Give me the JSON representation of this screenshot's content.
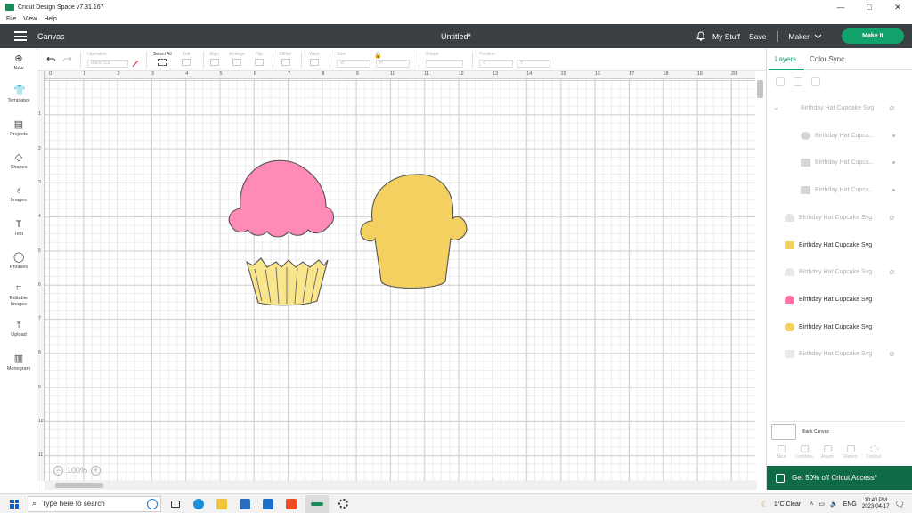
{
  "window": {
    "title": "Cricut Design Space  v7.31.167",
    "minimize": "—",
    "maximize": "□",
    "close": "✕"
  },
  "menu": [
    "File",
    "View",
    "Help"
  ],
  "header": {
    "canvas_label": "Canvas",
    "doc_title": "Untitled*",
    "my_stuff": "My Stuff",
    "save": "Save",
    "machine": "Maker",
    "make_it": "Make It"
  },
  "toolbar": {
    "operation": "Operation",
    "operation_value": "Basic Cut",
    "select_all": "Select All",
    "edit": "Edit",
    "align": "Align",
    "arrange": "Arrange",
    "flip": "Flip",
    "offset": "Offset",
    "warp": "Warp",
    "size": "Size",
    "rotate": "Rotate",
    "position": "Position",
    "w": "W",
    "h": "H",
    "x": "X",
    "y": "Y"
  },
  "leftnav": [
    {
      "label": "New",
      "icon": "plus-icon"
    },
    {
      "label": "Templates",
      "icon": "shirt-icon"
    },
    {
      "label": "Projects",
      "icon": "projects-icon"
    },
    {
      "label": "Shapes",
      "icon": "shapes-icon"
    },
    {
      "label": "Images",
      "icon": "bulb-icon"
    },
    {
      "label": "Text",
      "icon": "text-icon"
    },
    {
      "label": "Phrases",
      "icon": "chat-icon"
    },
    {
      "label": "Editable Images",
      "icon": "editable-icon"
    },
    {
      "label": "Upload",
      "icon": "upload-icon"
    },
    {
      "label": "Monogram",
      "icon": "monogram-icon"
    }
  ],
  "ruler": {
    "top": [
      "0",
      "1",
      "2",
      "3",
      "4",
      "5",
      "6",
      "7",
      "8",
      "9",
      "10",
      "11",
      "12",
      "13",
      "14",
      "15",
      "16",
      "17",
      "18",
      "19",
      "20"
    ],
    "left": [
      "1",
      "2",
      "3",
      "4",
      "5",
      "6",
      "7",
      "8",
      "9",
      "10",
      "11"
    ]
  },
  "zoom": {
    "minus": "−",
    "value": "100%",
    "plus": "+"
  },
  "panel": {
    "tab_layers": "Layers",
    "tab_color_sync": "Color Sync",
    "layers": [
      {
        "name": "Birthday Hat Cupcake Svg",
        "active": false,
        "kind": "group"
      },
      {
        "name": "Birthday Hat Cupca...",
        "active": false,
        "kind": "child"
      },
      {
        "name": "Birthday Hat Cupca...",
        "active": false,
        "kind": "child"
      },
      {
        "name": "Birthday Hat Cupca...",
        "active": false,
        "kind": "child"
      },
      {
        "name": "Birthday Hat Cupcake Svg",
        "active": false,
        "kind": "layer"
      },
      {
        "name": "Birthday Hat Cupcake Svg",
        "active": true,
        "kind": "layer"
      },
      {
        "name": "Birthday Hat Cupcake Svg",
        "active": false,
        "kind": "layer"
      },
      {
        "name": "Birthday Hat Cupcake Svg",
        "active": true,
        "kind": "layer"
      },
      {
        "name": "Birthday Hat Cupcake Svg",
        "active": true,
        "kind": "layer"
      },
      {
        "name": "Birthday Hat Cupcake Svg",
        "active": false,
        "kind": "layer"
      }
    ],
    "blank_canvas": "Blank Canvas",
    "bottom_tools": [
      "Slice",
      "Combine",
      "Attach",
      "Flatten",
      "Contour"
    ],
    "promo": "Get 50% off Cricut Access*"
  },
  "colors": {
    "header": "#3a3f44",
    "accent": "#12a26b",
    "frosting": "#ff8ab8",
    "wrapper": "#f8e58c",
    "cake": "#f4d060",
    "promo": "#0f6b45"
  },
  "taskbar": {
    "search_placeholder": "Type here to search",
    "weather": "1°C  Clear",
    "lang": "ENG",
    "time": "10:40 PM",
    "date": "2023-04-17"
  }
}
